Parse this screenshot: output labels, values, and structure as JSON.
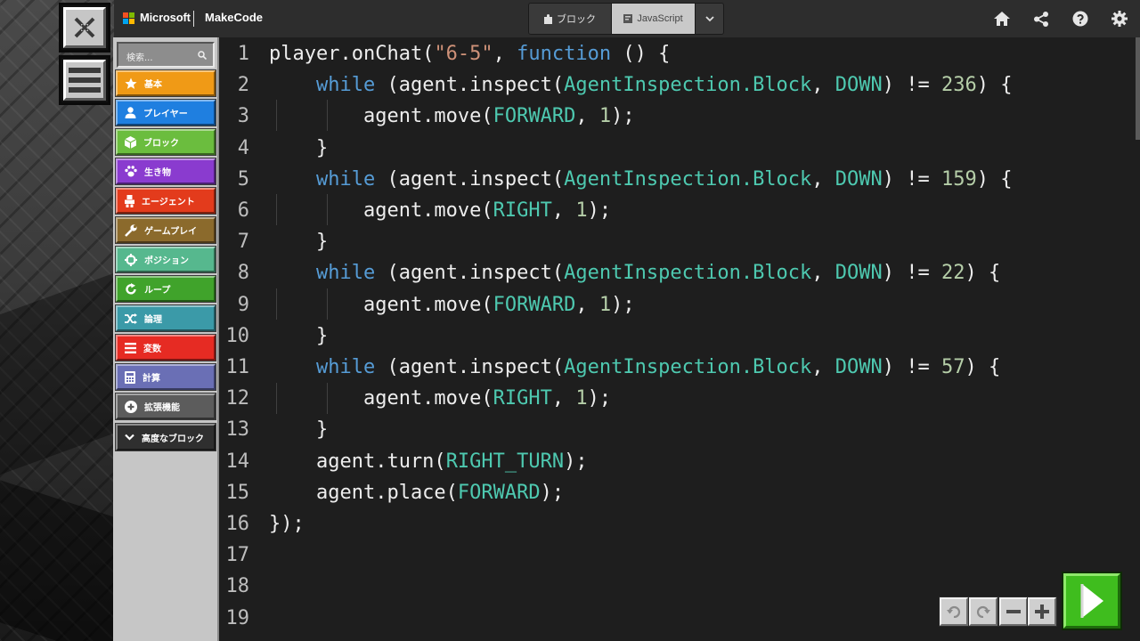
{
  "header": {
    "brand": "Microsoft",
    "product": "MakeCode",
    "blocks_tab": "ブロック",
    "js_tab": "JavaScript",
    "icons": [
      "home-icon",
      "share-icon",
      "help-icon",
      "settings-icon"
    ]
  },
  "toolbox": {
    "search_placeholder": "検索...",
    "categories": [
      {
        "label": "基本",
        "color": "#f09a16",
        "icon": "star-icon"
      },
      {
        "label": "プレイヤー",
        "color": "#1f7fe0",
        "icon": "person-icon"
      },
      {
        "label": "ブロック",
        "color": "#6bbd3e",
        "icon": "cube-icon"
      },
      {
        "label": "生き物",
        "color": "#8a3bcf",
        "icon": "paw-icon"
      },
      {
        "label": "エージェント",
        "color": "#e33b1c",
        "icon": "agent-icon"
      },
      {
        "label": "ゲームプレイ",
        "color": "#8b6a2c",
        "icon": "wrench-icon"
      },
      {
        "label": "ポジション",
        "color": "#56b88e",
        "icon": "crosshair-icon"
      },
      {
        "label": "ループ",
        "color": "#40a32b",
        "icon": "loop-icon"
      },
      {
        "label": "論理",
        "color": "#3b9aa8",
        "icon": "shuffle-icon"
      },
      {
        "label": "変数",
        "color": "#e62b23",
        "icon": "list-icon"
      },
      {
        "label": "計算",
        "color": "#6a6fb5",
        "icon": "calculator-icon"
      },
      {
        "label": "拡張機能",
        "color": "#5c5c5c",
        "icon": "plus-circle-icon"
      }
    ],
    "advanced_label": "高度なブロック"
  },
  "editor": {
    "lines": [
      [
        [
          "t",
          "player.onChat("
        ],
        [
          "s",
          "\"6-5\""
        ],
        [
          "t",
          ", "
        ],
        [
          "k",
          "function"
        ],
        [
          "t",
          " () {"
        ]
      ],
      [
        [
          "t",
          "    "
        ],
        [
          "k",
          "while"
        ],
        [
          "t",
          " (agent.inspect("
        ],
        [
          "c",
          "AgentInspection.Block"
        ],
        [
          "t",
          ", "
        ],
        [
          "c",
          "DOWN"
        ],
        [
          "t",
          ") != "
        ],
        [
          "n",
          "236"
        ],
        [
          "t",
          ") {"
        ]
      ],
      [
        [
          "t",
          "        agent.move("
        ],
        [
          "c",
          "FORWARD"
        ],
        [
          "t",
          ", "
        ],
        [
          "n",
          "1"
        ],
        [
          "t",
          ");"
        ]
      ],
      [
        [
          "t",
          "    }"
        ]
      ],
      [
        [
          "t",
          "    "
        ],
        [
          "k",
          "while"
        ],
        [
          "t",
          " (agent.inspect("
        ],
        [
          "c",
          "AgentInspection.Block"
        ],
        [
          "t",
          ", "
        ],
        [
          "c",
          "DOWN"
        ],
        [
          "t",
          ") != "
        ],
        [
          "n",
          "159"
        ],
        [
          "t",
          ") {"
        ]
      ],
      [
        [
          "t",
          "        agent.move("
        ],
        [
          "c",
          "RIGHT"
        ],
        [
          "t",
          ", "
        ],
        [
          "n",
          "1"
        ],
        [
          "t",
          ");"
        ]
      ],
      [
        [
          "t",
          "    }"
        ]
      ],
      [
        [
          "t",
          "    "
        ],
        [
          "k",
          "while"
        ],
        [
          "t",
          " (agent.inspect("
        ],
        [
          "c",
          "AgentInspection.Block"
        ],
        [
          "t",
          ", "
        ],
        [
          "c",
          "DOWN"
        ],
        [
          "t",
          ") != "
        ],
        [
          "n",
          "22"
        ],
        [
          "t",
          ") {"
        ]
      ],
      [
        [
          "t",
          "        agent.move("
        ],
        [
          "c",
          "FORWARD"
        ],
        [
          "t",
          ", "
        ],
        [
          "n",
          "1"
        ],
        [
          "t",
          ");"
        ]
      ],
      [
        [
          "t",
          "    }"
        ]
      ],
      [
        [
          "t",
          "    "
        ],
        [
          "k",
          "while"
        ],
        [
          "t",
          " (agent.inspect("
        ],
        [
          "c",
          "AgentInspection.Block"
        ],
        [
          "t",
          ", "
        ],
        [
          "c",
          "DOWN"
        ],
        [
          "t",
          ") != "
        ],
        [
          "n",
          "57"
        ],
        [
          "t",
          ") {"
        ]
      ],
      [
        [
          "t",
          "        agent.move("
        ],
        [
          "c",
          "RIGHT"
        ],
        [
          "t",
          ", "
        ],
        [
          "n",
          "1"
        ],
        [
          "t",
          ");"
        ]
      ],
      [
        [
          "t",
          "    }"
        ]
      ],
      [
        [
          "t",
          "    agent.turn("
        ],
        [
          "c",
          "RIGHT_TURN"
        ],
        [
          "t",
          ");"
        ]
      ],
      [
        [
          "t",
          "    agent.place("
        ],
        [
          "c",
          "FORWARD"
        ],
        [
          "t",
          ");"
        ]
      ],
      [
        [
          "t",
          "});"
        ]
      ],
      [],
      [],
      []
    ],
    "token_colors": {
      "t": "#ededed",
      "k": "#569cd6",
      "s": "#ce9178",
      "c": "#4ec9b0",
      "n": "#b5cea8"
    }
  },
  "controls": {
    "icons": [
      "undo-icon",
      "redo-icon",
      "zoom-out-icon",
      "zoom-in-icon",
      "run-icon"
    ],
    "run_color": "#3fbd1e"
  }
}
